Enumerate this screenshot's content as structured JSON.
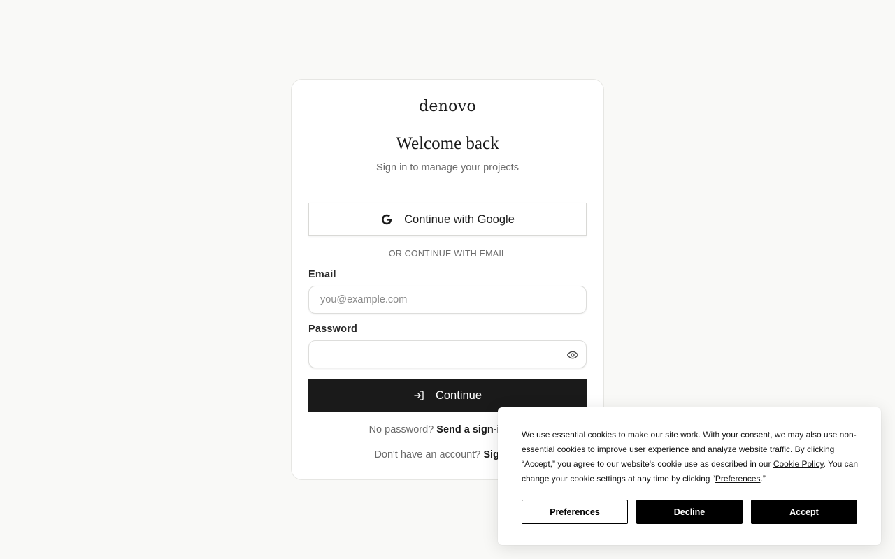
{
  "brand": {
    "logo_text": "denovo"
  },
  "auth": {
    "title": "Welcome back",
    "subtitle": "Sign in to manage your projects",
    "google_button": "Continue with Google",
    "divider": "OR CONTINUE WITH EMAIL",
    "email_label": "Email",
    "email_placeholder": "you@example.com",
    "email_value": "",
    "password_label": "Password",
    "password_value": "",
    "continue_button": "Continue",
    "no_password_prefix": "No password?",
    "no_password_link": "Send a sign-in link",
    "signup_prefix": "Don't have an account?",
    "signup_link": "Sign up"
  },
  "cookie_banner": {
    "text_part1": "We use essential cookies to make our site work. With your consent, we may also use non-essential cookies to improve user experience and analyze website traffic. By clicking “Accept,” you agree to our website's cookie use as described in our ",
    "cookie_policy_link": "Cookie Policy",
    "text_part2": ". You can change your cookie settings at any time by clicking “",
    "preferences_link": "Preferences",
    "text_part3": ".”",
    "preferences_button": "Preferences",
    "decline_button": "Decline",
    "accept_button": "Accept"
  },
  "icons": {
    "google": "google-g-icon",
    "eye": "eye-icon",
    "sign_in": "sign-in-arrow-icon"
  },
  "colors": {
    "background": "#f9f9f7",
    "primary_button": "#1a1a1a",
    "muted_text": "#6b6b6b"
  }
}
